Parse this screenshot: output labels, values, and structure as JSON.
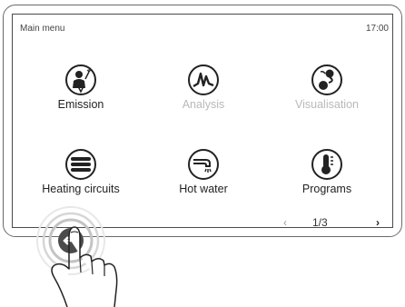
{
  "header": {
    "title": "Main menu",
    "time": "17:00"
  },
  "tiles": [
    {
      "label": "Emission",
      "icon": "emission-icon",
      "enabled": true
    },
    {
      "label": "Analysis",
      "icon": "analysis-icon",
      "enabled": false
    },
    {
      "label": "Visualisation",
      "icon": "visualisation-icon",
      "enabled": false
    },
    {
      "label": "Heating circuits",
      "icon": "heating-circuits-icon",
      "enabled": true
    },
    {
      "label": "Hot water",
      "icon": "hot-water-icon",
      "enabled": true
    },
    {
      "label": "Programs",
      "icon": "programs-icon",
      "enabled": true
    }
  ],
  "pager": {
    "indicator": "1/3",
    "prev_icon": "chevron-left-icon",
    "next_icon": "chevron-right-icon"
  },
  "back_button": {
    "icon": "back-arrow-icon"
  },
  "colors": {
    "enabled_text": "#222222",
    "disabled_text": "#b9b9b9",
    "border": "#4a4a4a"
  }
}
